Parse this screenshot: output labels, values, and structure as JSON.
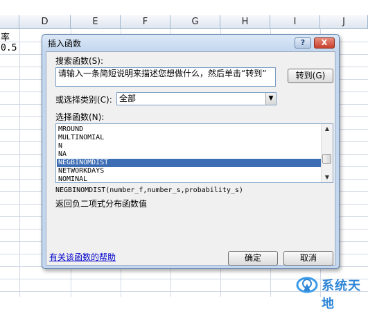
{
  "sheet": {
    "columns": [
      "D",
      "E",
      "F",
      "G",
      "H",
      "I",
      "J"
    ],
    "cells": [
      {
        "text": "率"
      },
      {
        "text": "0.5"
      }
    ]
  },
  "dialog": {
    "title": "插入函数",
    "help_button": "?",
    "close_button": "X",
    "search_label": "搜索函数(S):",
    "search_value": "请输入一条简短说明来描述您想做什么，然后单击“转到”",
    "go_button": "转到(G)",
    "category_label": "或选择类别(C):",
    "category_value": "全部",
    "function_list_label": "选择函数(N):",
    "functions": [
      "MROUND",
      "MULTINOMIAL",
      "N",
      "NA",
      "NEGBINOMDIST",
      "NETWORKDAYS",
      "NOMINAL"
    ],
    "selected_function": "NEGBINOMDIST",
    "syntax": "NEGBINOMDIST(number_f,number_s,probability_s)",
    "description": "返回负二项式分布函数值",
    "help_link": "有关该函数的帮助",
    "ok_button": "确定",
    "cancel_button": "取消"
  },
  "watermark": {
    "text": "系统天地"
  },
  "colors": {
    "selection": "#3d6db4",
    "dialog_frame": "#c4d7ee",
    "link": "#0000cc"
  }
}
